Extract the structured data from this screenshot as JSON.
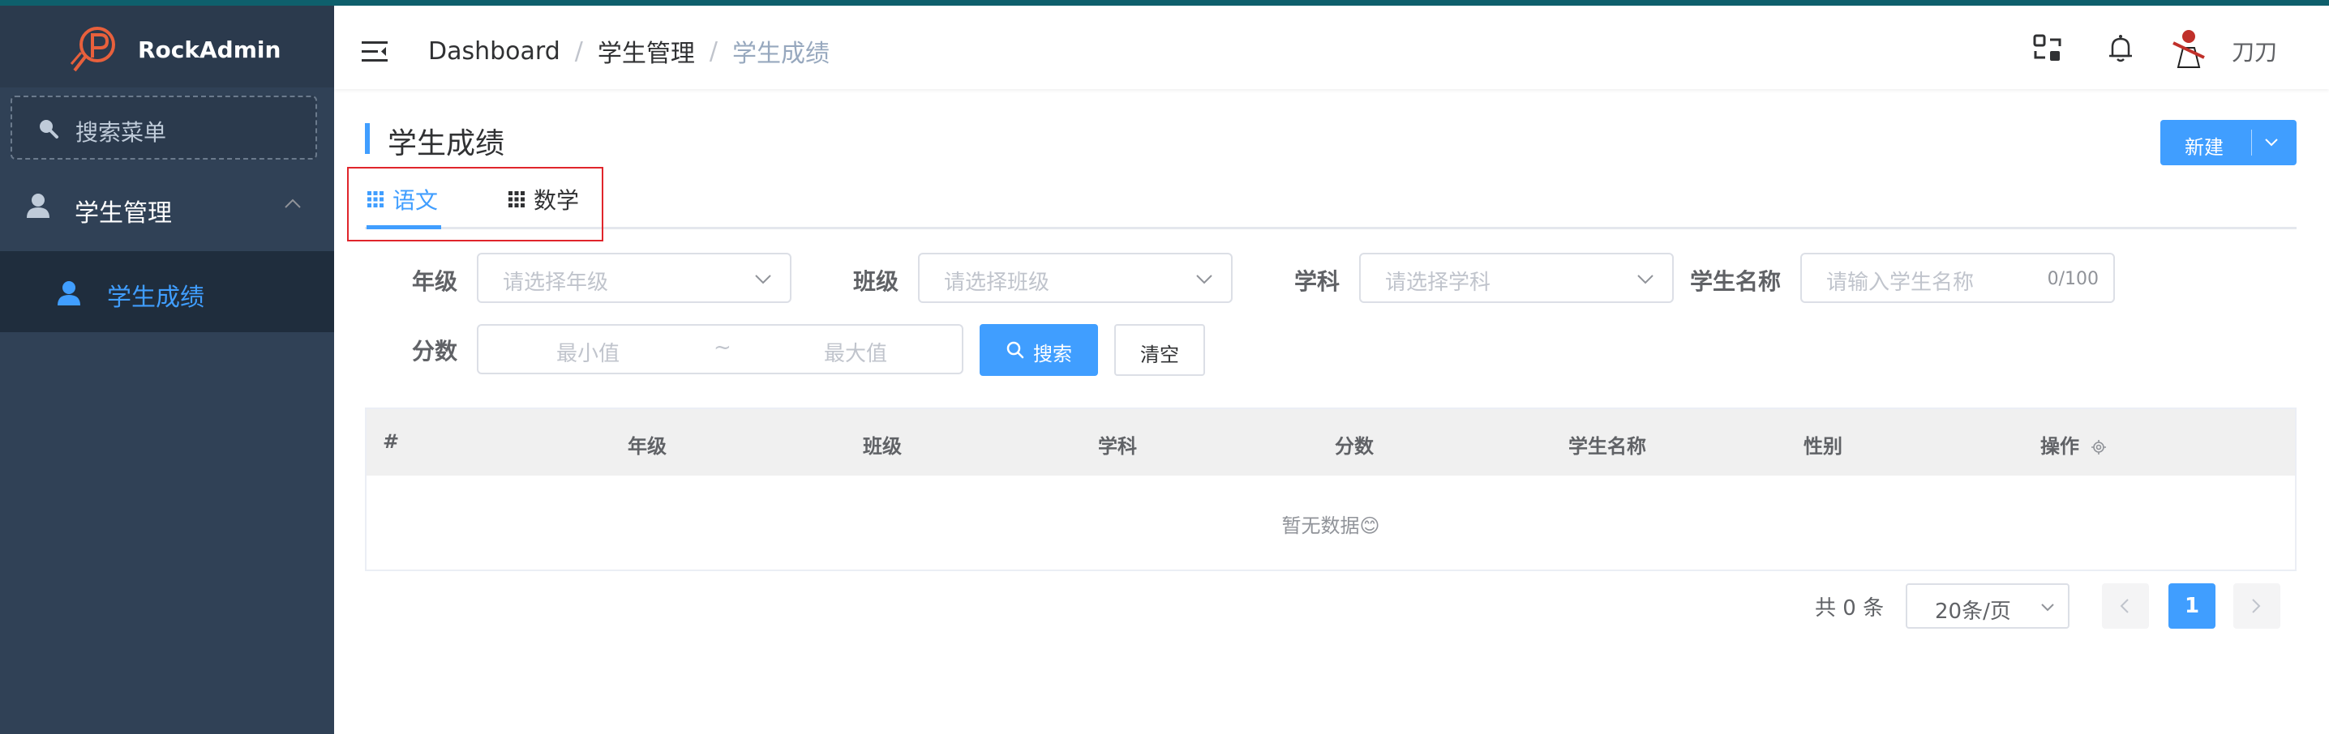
{
  "app": {
    "name": "RockAdmin"
  },
  "sidebar": {
    "search_label": "搜索菜单",
    "group": {
      "label": "学生管理"
    },
    "items": [
      {
        "label": "学生成绩"
      }
    ]
  },
  "header": {
    "breadcrumb": [
      "Dashboard",
      "学生管理",
      "学生成绩"
    ],
    "separator": "/",
    "username": "刀刀"
  },
  "page": {
    "title": "学生成绩",
    "new_button": "新建",
    "tabs": [
      {
        "label": "语文"
      },
      {
        "label": "数学"
      }
    ]
  },
  "filters": {
    "grade_label": "年级",
    "grade_placeholder": "请选择年级",
    "class_label": "班级",
    "class_placeholder": "请选择班级",
    "subject_label": "学科",
    "subject_placeholder": "请选择学科",
    "name_label": "学生名称",
    "name_placeholder": "请输入学生名称",
    "name_count": "0/100",
    "score_label": "分数",
    "score_min": "最小值",
    "score_sep": "~",
    "score_max": "最大值",
    "search_button": "搜索",
    "clear_button": "清空"
  },
  "table": {
    "columns": [
      "#",
      "年级",
      "班级",
      "学科",
      "分数",
      "学生名称",
      "性别",
      "操作"
    ],
    "empty_text": "暂无数据😊"
  },
  "pagination": {
    "total": "共 0 条",
    "page_size": "20条/页",
    "current_page": "1"
  },
  "colors": {
    "accent": "#409eff",
    "sidebar": "#304156",
    "highlight": "#e0252b"
  },
  "icons": [
    "logo-icon",
    "search-icon",
    "user-icon",
    "chevron-up-icon",
    "hamburger-icon",
    "screen-switch-icon",
    "bell-icon",
    "grid-icon",
    "chevron-down-icon",
    "gear-icon",
    "chevron-left-icon",
    "chevron-right-icon"
  ]
}
